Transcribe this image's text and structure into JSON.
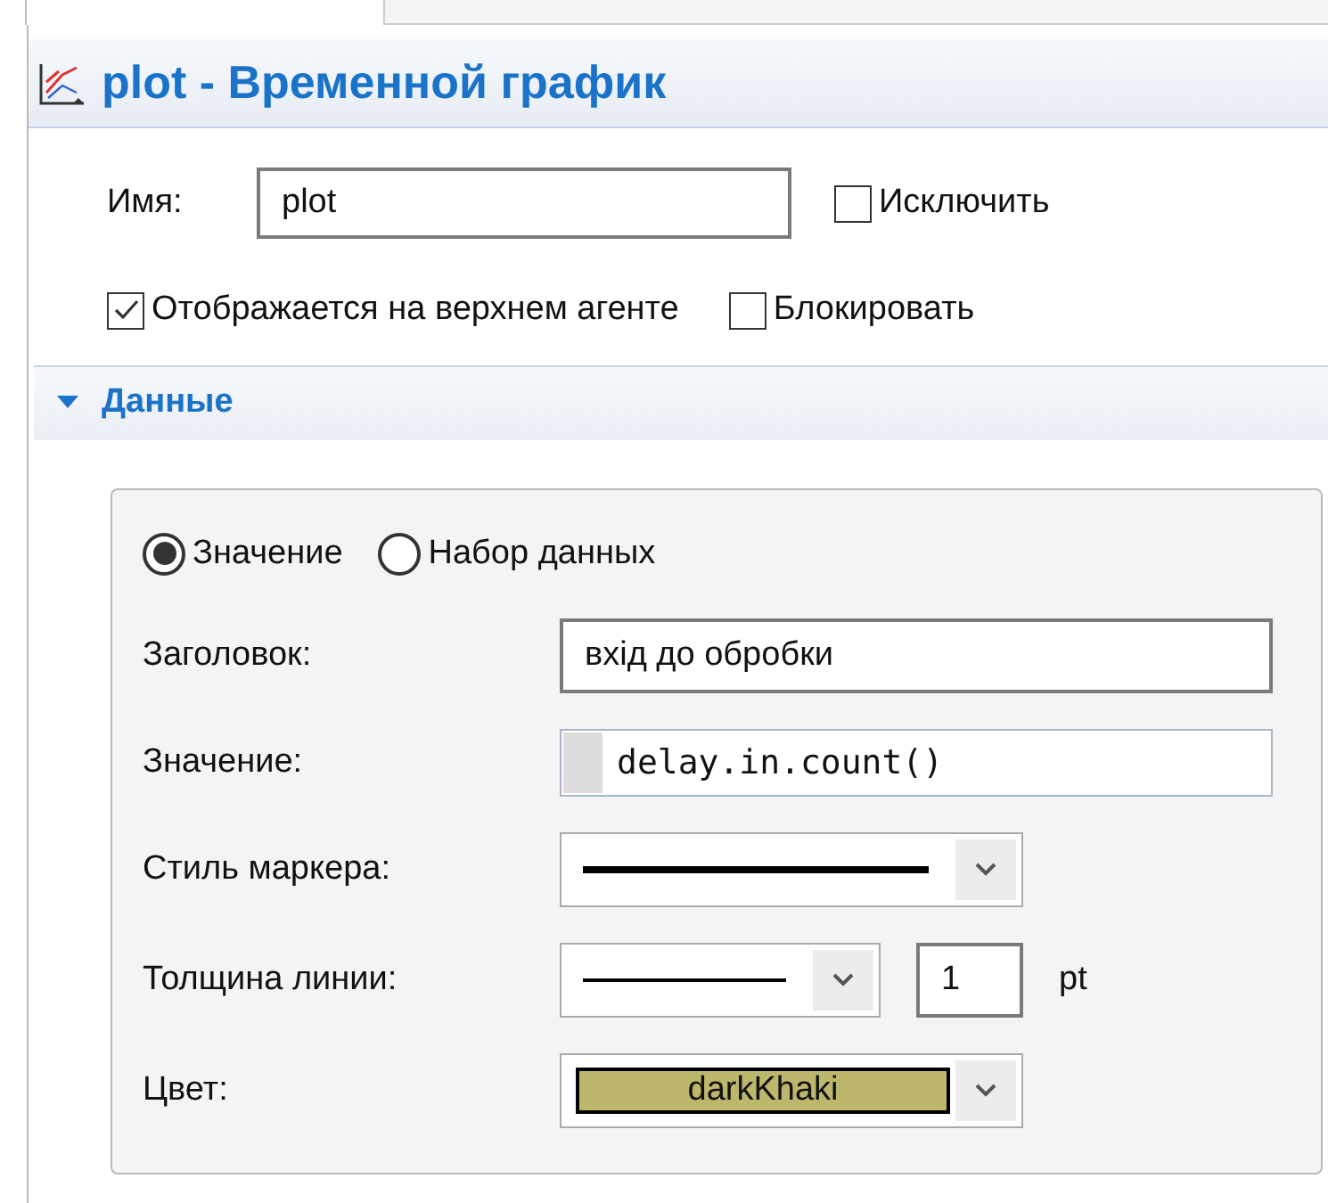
{
  "header": {
    "title": "plot - Временной график"
  },
  "name_field": {
    "label": "Имя:",
    "value": "plot"
  },
  "checkboxes": [
    {
      "label": "Исключить",
      "checked": false
    },
    {
      "label": "Отображается на верхнем агенте",
      "checked": true
    },
    {
      "label": "Блокировать",
      "checked": false
    }
  ],
  "section": {
    "title": "Данные",
    "expanded": true
  },
  "radios": [
    {
      "label": "Значение",
      "selected": true
    },
    {
      "label": "Набор данных",
      "selected": false
    }
  ],
  "fields": [
    {
      "kind": "text",
      "label": "Заголовок:",
      "value": "вхід до обробки"
    },
    {
      "kind": "code",
      "label": "Значение:",
      "value": "delay.in.count()"
    },
    {
      "kind": "line",
      "label": "Стиль маркера:"
    },
    {
      "kind": "thickness",
      "label": "Толщина линии:",
      "value": "1",
      "unit": "pt"
    },
    {
      "kind": "color",
      "label": "Цвет:",
      "value": "darkKhaki",
      "color": "#bdb76b"
    }
  ]
}
